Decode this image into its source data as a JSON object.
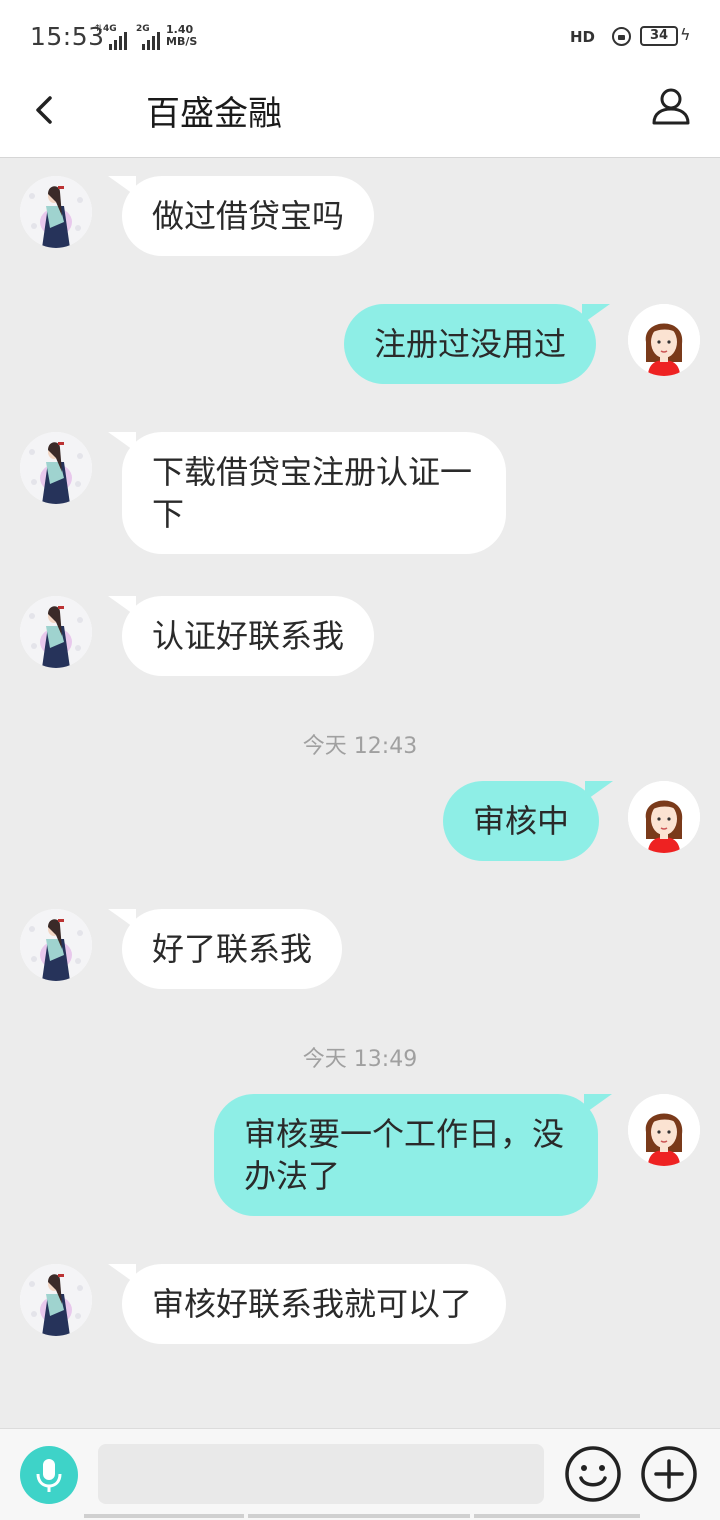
{
  "status_bar": {
    "time": "15:53",
    "net1": "4G",
    "net2": "2G",
    "speed_value": "1.40",
    "speed_unit": "MB/S",
    "hd": "HD",
    "battery": "34"
  },
  "header": {
    "title": "百盛金融"
  },
  "messages": [
    {
      "side": "in",
      "text": "做过借贷宝吗"
    },
    {
      "side": "out",
      "text": "注册过没用过"
    },
    {
      "side": "in",
      "text": "下载借贷宝注册认证一下"
    },
    {
      "side": "in",
      "text": "认证好联系我"
    },
    {
      "side": "time",
      "text": "今天 12:43"
    },
    {
      "side": "out",
      "text": "审核中"
    },
    {
      "side": "in",
      "text": "好了联系我"
    },
    {
      "side": "time",
      "text": "今天 13:49"
    },
    {
      "side": "out",
      "text": "审核要一个工作日，没办法了"
    },
    {
      "side": "in",
      "text": "审核好联系我就可以了"
    }
  ],
  "input": {
    "placeholder": ""
  },
  "colors": {
    "accent": "#3ed3c8",
    "outgoing_bubble": "#8eeee6",
    "incoming_bubble": "#ffffff",
    "background": "#ececec"
  },
  "icons": [
    "back-arrow-icon",
    "profile-icon",
    "microphone-icon",
    "emoji-icon",
    "plus-icon"
  ]
}
